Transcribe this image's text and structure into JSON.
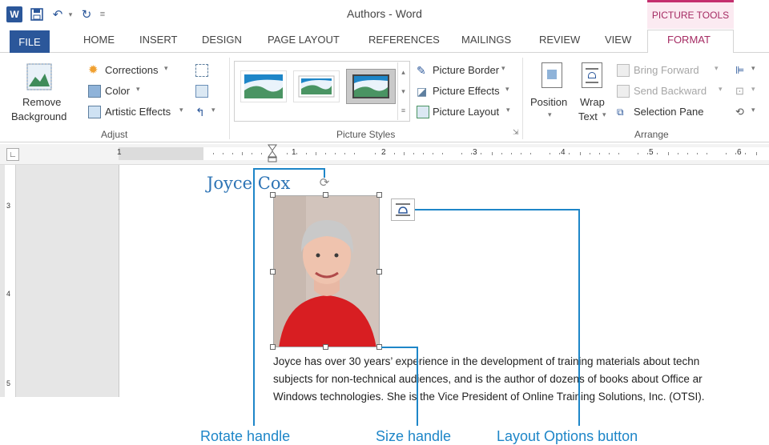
{
  "window": {
    "title": "Authors - Word",
    "contextual_group": "PICTURE TOOLS"
  },
  "tabs": [
    "FILE",
    "HOME",
    "INSERT",
    "DESIGN",
    "PAGE LAYOUT",
    "REFERENCES",
    "MAILINGS",
    "REVIEW",
    "VIEW",
    "FORMAT"
  ],
  "ribbon": {
    "adjust": {
      "label": "Adjust",
      "remove_background": [
        "Remove",
        "Background"
      ],
      "corrections": "Corrections",
      "color": "Color",
      "artistic_effects": "Artistic Effects"
    },
    "picture_styles": {
      "label": "Picture Styles",
      "picture_border": "Picture Border",
      "picture_effects": "Picture Effects",
      "picture_layout": "Picture Layout"
    },
    "arrange": {
      "label": "Arrange",
      "position": "Position",
      "wrap_text": [
        "Wrap",
        "Text"
      ],
      "bring_forward": "Bring Forward",
      "send_backward": "Send Backward",
      "selection_pane": "Selection Pane"
    }
  },
  "ruler": {
    "numbers": [
      "1",
      "1",
      "2",
      "3",
      "4",
      "5",
      "6"
    ]
  },
  "vruler": {
    "numbers": [
      "3",
      "4",
      "5"
    ]
  },
  "document": {
    "heading": "Joyce Cox",
    "body_lines": [
      "Joyce has over 30 years’ experience in the development of training materials about techn",
      "subjects for non-technical audiences, and is the author of dozens of books about Office ar",
      "Windows technologies. She is the Vice President of Online Training Solutions, Inc. (OTSI)."
    ]
  },
  "callouts": {
    "rotate": "Rotate handle",
    "size": "Size handle",
    "layout": "Layout Options button"
  },
  "colors": {
    "accent": "#2b579a",
    "picture_tools": "#c4306f",
    "callout": "#1e86c8",
    "heading": "#2e74b5"
  }
}
